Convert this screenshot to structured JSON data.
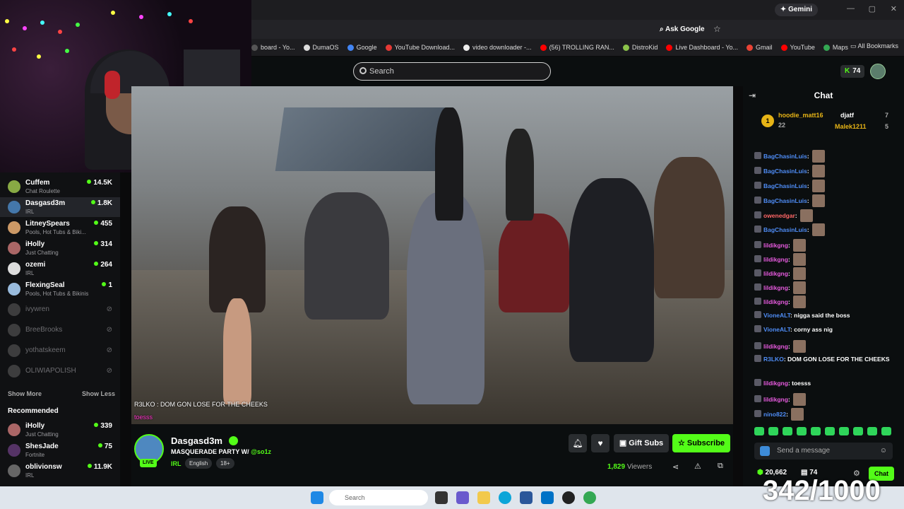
{
  "browser": {
    "gemini": "Gemini",
    "ask_google": "Ask Google",
    "bookmarks": [
      "board - Yo...",
      "DumaOS",
      "Google",
      "YouTube Download...",
      "video downloader -...",
      "(56) TROLLING RAN...",
      "DistroKid",
      "Live Dashboard - Yo...",
      "Gmail",
      "YouTube",
      "Maps"
    ],
    "all_bookmarks": "All Bookmarks"
  },
  "header": {
    "search_placeholder": "Search",
    "points": "74"
  },
  "sidebar": {
    "channels": [
      {
        "name": "Cuffem",
        "category": "Chat Roulette",
        "viewers": "14.5K"
      },
      {
        "name": "Dasgasd3m",
        "category": "IRL",
        "viewers": "1.8K"
      },
      {
        "name": "LitneySpears",
        "category": "Pools, Hot Tubs & Biki...",
        "viewers": "455"
      },
      {
        "name": "iHolly",
        "category": "Just Chatting",
        "viewers": "314"
      },
      {
        "name": "ozemi",
        "category": "IRL",
        "viewers": "264"
      },
      {
        "name": "FlexingSeal",
        "category": "Pools, Hot Tubs & Bikinis",
        "viewers": "1"
      }
    ],
    "offline": [
      "ivywren",
      "BreeBrooks",
      "yothatskeem",
      "OLIWIAPOLISH"
    ],
    "show_more": "Show More",
    "show_less": "Show Less",
    "recommended_title": "Recommended",
    "recommended": [
      {
        "name": "iHolly",
        "category": "Just Chatting",
        "viewers": "339"
      },
      {
        "name": "ShesJade",
        "category": "Fortnite",
        "viewers": "75"
      },
      {
        "name": "oblivionsw",
        "category": "IRL",
        "viewers": "11.9K"
      }
    ],
    "sidechat": "toesss"
  },
  "video": {
    "overlay_line1": "R3LKO : DOM GON LOSE FOR THE CHEEKS",
    "overlay_line2": "toesss"
  },
  "stream": {
    "streamer": "Dasgasd3m",
    "title": "MASQUERADE PARTY W/",
    "title_tag": "@so1z",
    "category": "IRL",
    "tags": [
      "English",
      "18+"
    ],
    "live": "LIVE",
    "gift_subs": "Gift Subs",
    "subscribe": "Subscribe",
    "viewers": "1,829",
    "viewers_label": "Viewers"
  },
  "chat": {
    "title": "Chat",
    "gifters": [
      {
        "name": "hoodie_matt16",
        "count": "22"
      },
      {
        "name": "djatf",
        "count": "7"
      },
      {
        "name": "Malek1211",
        "count": "5"
      }
    ],
    "rank": "1",
    "messages": [
      {
        "user": "BagChasinLuis",
        "text": ""
      },
      {
        "user": "BagChasinLuis",
        "text": ""
      },
      {
        "user": "BagChasinLuis",
        "text": ""
      },
      {
        "user": "BagChasinLuis",
        "text": ""
      },
      {
        "user": "owenedgar",
        "text": ""
      },
      {
        "user": "BagChasinLuis",
        "text": ""
      },
      {
        "user": "lildikgng",
        "text": ""
      },
      {
        "user": "lildikgng",
        "text": ""
      },
      {
        "user": "lildikgng",
        "text": ""
      },
      {
        "user": "lildikgng",
        "text": ""
      },
      {
        "user": "lildikgng",
        "text": ""
      },
      {
        "user": "VioneALT",
        "text": "nigga said the boss"
      },
      {
        "user": "VioneALT",
        "text": "corny ass nig"
      },
      {
        "user": "lildikgng",
        "text": ""
      },
      {
        "user": "R3LKO",
        "text": "DOM GON LOSE FOR THE CHEEKS"
      },
      {
        "user": "lildikgng",
        "text": "toesss"
      },
      {
        "user": "lildikgng",
        "text": ""
      },
      {
        "user": "nino822",
        "text": ""
      }
    ],
    "input_placeholder": "Send a message",
    "points": "20,662",
    "subs_count": "74",
    "chat_button": "Chat"
  },
  "taskbar": {
    "search": "Search"
  },
  "counter": "342/1000"
}
